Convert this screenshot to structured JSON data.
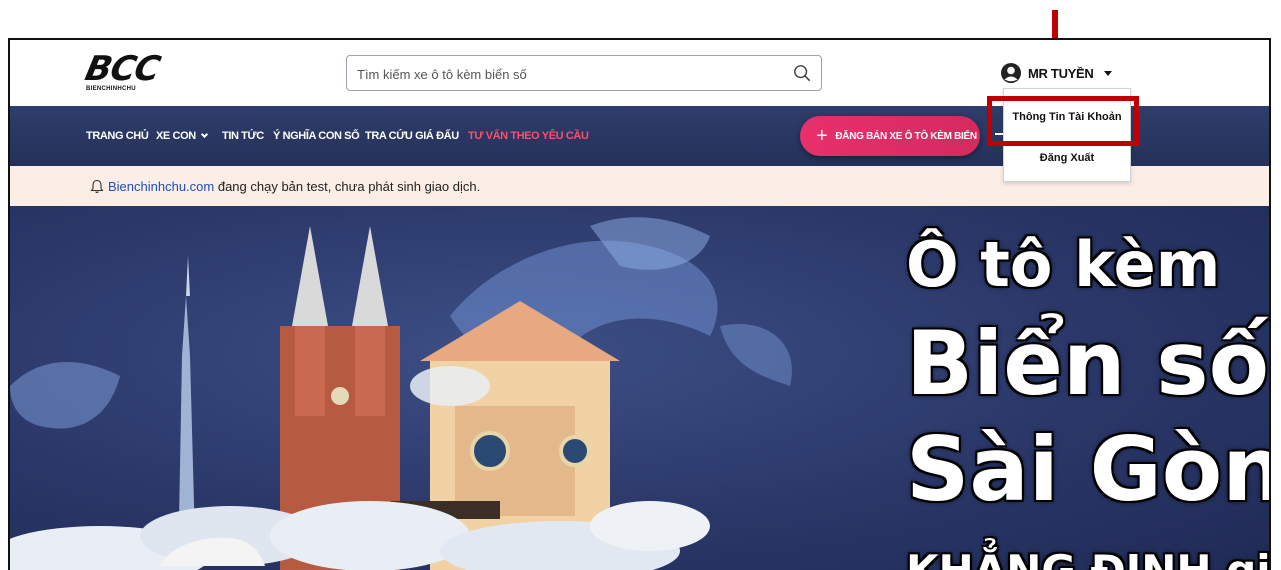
{
  "header": {
    "logo_text": "BCC",
    "logo_sub": "BIENCHINHCHU",
    "search_placeholder": "Tìm kiếm xe ô tô kèm biển số",
    "user_name": "MR TUYỀN"
  },
  "nav": {
    "items": [
      "TRANG CHỦ",
      "XE CON",
      "TIN TỨC",
      "Ý NGHĨA CON SỐ",
      "TRA CỨU GIÁ ĐẤU",
      "TƯ VẤN THEO YÊU CẦU"
    ],
    "post_button": "ĐĂNG BÁN XE Ô TÔ KÈM BIỂN"
  },
  "notice": {
    "link_text": "Bienchinhchu.com",
    "text": " đang chạy bản test, chưa phát sinh giao dịch."
  },
  "user_menu": {
    "items": [
      "Thông Tin Tài Khoản",
      "Đăng Xuất"
    ]
  },
  "hero": {
    "line1": "Ô tô kèm",
    "line2": "Biển số",
    "line3": "Sài Gòn",
    "line4": "KHẲNG ĐỊNH giá trị"
  },
  "colors": {
    "nav_bg": "#2a3766",
    "accent_pink": "#e8306a",
    "annotation_red": "#c00000",
    "notice_bg": "#fbeee6"
  },
  "icons": [
    "arrow-down-icon",
    "search-icon",
    "user-icon",
    "chevron-down-icon",
    "plus-icon",
    "bell-icon"
  ]
}
